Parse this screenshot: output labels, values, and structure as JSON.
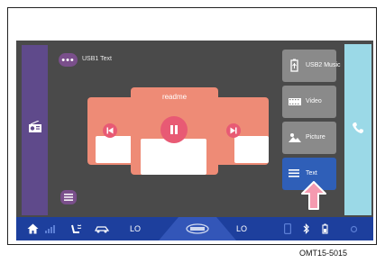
{
  "screen": {
    "source_label": "USB1 Text",
    "track_title": "readme"
  },
  "side_menu": [
    {
      "label": "USB2 Music",
      "icon": "usb-icon",
      "active": false
    },
    {
      "label": "Video",
      "icon": "film-icon",
      "active": false
    },
    {
      "label": "Picture",
      "icon": "picture-icon",
      "active": false
    },
    {
      "label": "Text",
      "icon": "text-icon",
      "active": true
    }
  ],
  "climate": {
    "left_temp": "LO",
    "right_temp": "LO"
  },
  "caption": "OMT15-5015",
  "colors": {
    "screen_bg": "#4a4a4a",
    "card": "#ee8b76",
    "control": "#e85a74",
    "bottom_bar": "#1d3f9d",
    "active_item": "#2f5fb8",
    "left_strip": "#5f4a8b",
    "right_strip": "#9bd9e7"
  }
}
